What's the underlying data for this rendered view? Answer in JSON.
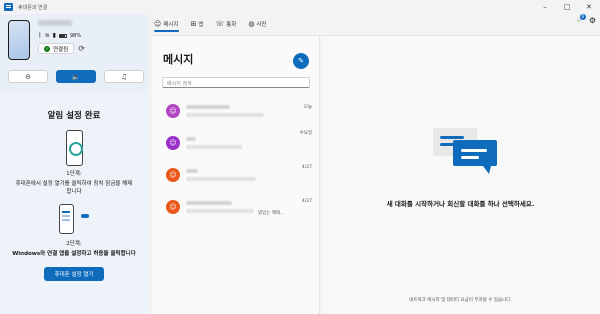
{
  "app": {
    "title": "휴대폰과 연결"
  },
  "window_controls": [
    "minimize",
    "maximize",
    "close"
  ],
  "device": {
    "name": "",
    "battery": "98%",
    "connection_status": "연결됨"
  },
  "audio_modes": [
    {
      "icon": "do-not-disturb-icon",
      "glyph": "⊖",
      "active": false
    },
    {
      "icon": "speaker-icon",
      "glyph": "🔈",
      "active": true
    },
    {
      "icon": "music-icon",
      "glyph": "♫",
      "active": false
    }
  ],
  "setup": {
    "title": "알림 설정 완료",
    "step1_label": "1단계:",
    "step1_desc": "휴대폰에서 설정 열기를 클릭하여 장치 잠금을 해제합니다",
    "step2_label": "2단계:",
    "step2_desc": "Windows와 연결 앱을 설정하고 허용을 클릭합니다",
    "open_settings_button": "휴대폰 설정 열기"
  },
  "nav": {
    "tabs": [
      {
        "label": "메시지",
        "icon": "chat-icon",
        "glyph": "☺",
        "active": true
      },
      {
        "label": "앱",
        "icon": "apps-icon",
        "glyph": "⊞",
        "active": false
      },
      {
        "label": "통화",
        "icon": "phone-icon",
        "glyph": "☏",
        "active": false
      },
      {
        "label": "사진",
        "icon": "photos-icon",
        "glyph": "◍",
        "active": false
      }
    ],
    "notification_count": "6"
  },
  "messages": {
    "title": "메시지",
    "search_placeholder": "메시지 검색",
    "conversations": [
      {
        "avatar_color": "#b146c2",
        "time": "오늘",
        "preview": ""
      },
      {
        "avatar_color": "#9a2fc9",
        "time": "수요일",
        "preview": ""
      },
      {
        "avatar_color": "#e8591a",
        "time": "4/27",
        "preview": ""
      },
      {
        "avatar_color": "#e8591a",
        "time": "4/27",
        "preview": "였있는 혜택..."
      }
    ]
  },
  "conversation_view": {
    "empty_message": "새 대화를 시작하거나 회신할 대화를 하나 선택하세요.",
    "footer_note": "네트워크 메시지 및 데이터 요금이 부과될 수 있습니다."
  }
}
